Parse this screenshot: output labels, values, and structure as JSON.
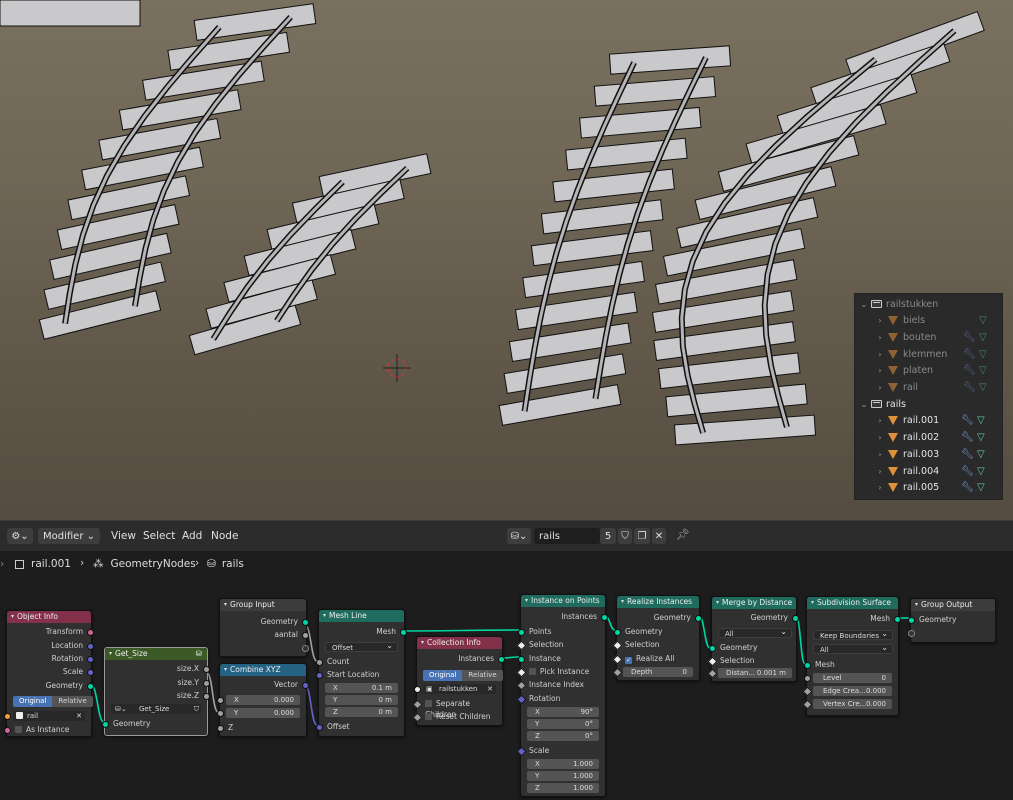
{
  "outliner": {
    "collections": [
      {
        "name": "railstukken",
        "dim": true,
        "children": [
          {
            "name": "biels"
          },
          {
            "name": "bouten"
          },
          {
            "name": "klemmen"
          },
          {
            "name": "platen"
          },
          {
            "name": "rail"
          }
        ]
      },
      {
        "name": "rails",
        "dim": false,
        "children": [
          {
            "name": "rail.001"
          },
          {
            "name": "rail.002"
          },
          {
            "name": "rail.003"
          },
          {
            "name": "rail.004"
          },
          {
            "name": "rail.005"
          }
        ]
      }
    ]
  },
  "header": {
    "mode": "Modifier",
    "menus": [
      "View",
      "Select",
      "Add",
      "Node"
    ],
    "node_group_name": "rails",
    "user_count": "5"
  },
  "breadcrumb": [
    "rail.001",
    "GeometryNodes",
    "rails"
  ],
  "nodes": {
    "object_info": {
      "title": "Object Info",
      "outputs": [
        "Transform",
        "Location",
        "Rotation",
        "Scale",
        "Geometry"
      ],
      "toggle": [
        "Original",
        "Relative"
      ],
      "object": "rail",
      "as_instance": "As Instance"
    },
    "get_size": {
      "title": "Get_Size",
      "outputs": [
        "size.X",
        "size.Y",
        "size.Z"
      ],
      "group": "Get_Size",
      "input": "Geometry"
    },
    "group_input": {
      "title": "Group Input",
      "outputs": [
        "Geometry",
        "aantal"
      ]
    },
    "combine_xyz": {
      "title": "Combine XYZ",
      "output": "Vector",
      "x_label": "X",
      "x_val": "0.000",
      "y_label": "Y",
      "y_val": "0.000",
      "z_label": "Z"
    },
    "mesh_line": {
      "title": "Mesh Line",
      "output": "Mesh",
      "mode": "Offset",
      "count": "Count",
      "start": "Start Location",
      "x_label": "X",
      "x": "0.1 m",
      "y_label": "Y",
      "y": "0 m",
      "z_label": "Z",
      "z": "0 m",
      "offset": "Offset"
    },
    "collection_info": {
      "title": "Collection Info",
      "output": "Instances",
      "toggle": [
        "Original",
        "Relative"
      ],
      "collection": "railstukken",
      "sep": "Separate Children",
      "reset": "Reset Children"
    },
    "instance_on_points": {
      "title": "Instance on Points",
      "output": "Instances",
      "inputs": [
        "Points",
        "Selection",
        "Instance",
        "Pick Instance",
        "Instance Index",
        "Rotation"
      ],
      "rot": [
        {
          "l": "X",
          "v": "90°"
        },
        {
          "l": "Y",
          "v": "0°"
        },
        {
          "l": "Z",
          "v": "0°"
        }
      ],
      "scale": "Scale",
      "scl": [
        {
          "l": "X",
          "v": "1.000"
        },
        {
          "l": "Y",
          "v": "1.000"
        },
        {
          "l": "Z",
          "v": "1.000"
        }
      ]
    },
    "realize_instances": {
      "title": "Realize Instances",
      "output": "Geometry",
      "inputs": [
        "Geometry",
        "Selection"
      ],
      "realize_all": "Realize All",
      "depth_label": "Depth",
      "depth": "0"
    },
    "merge_by_distance": {
      "title": "Merge by Distance",
      "output": "Geometry",
      "mode": "All",
      "inputs": [
        "Geometry",
        "Selection"
      ],
      "dist_label": "Distan...",
      "dist": "0.001 m"
    },
    "subdivision_surface": {
      "title": "Subdivision Surface",
      "output": "Mesh",
      "boundary": "Keep Boundaries",
      "uv": "All",
      "input": "Mesh",
      "fields": [
        {
          "l": "Level",
          "v": "0"
        },
        {
          "l": "Edge Crea...",
          "v": "0.000"
        },
        {
          "l": "Vertex Cre...",
          "v": "0.000"
        }
      ]
    },
    "group_output": {
      "title": "Group Output",
      "input": "Geometry"
    }
  },
  "colors": {
    "geometry_socket": "#00d6a3",
    "vector_socket": "#6363c7",
    "float_socket": "#a1a1a1",
    "object_header": "#83314a",
    "group_header": "#3b5a25",
    "converter_header": "#246283",
    "geometry_header": "#1f6b5e",
    "input_header": "#83314a"
  }
}
